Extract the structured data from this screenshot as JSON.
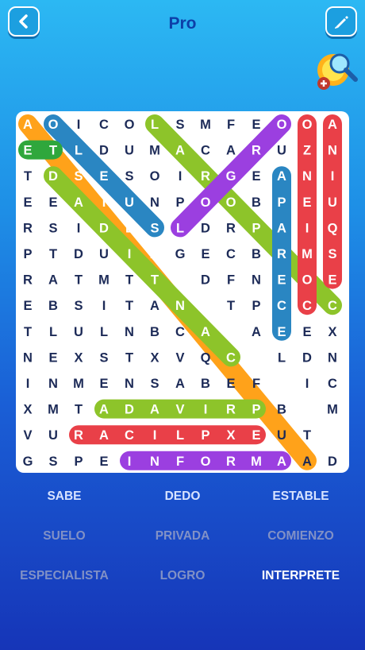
{
  "header": {
    "title": "Pro",
    "back_icon": "chevron-left-icon",
    "edit_icon": "pencil-icon",
    "hint_icon": "magnifier-hint-icon"
  },
  "grid": {
    "rows": [
      "AOICOLSMFEOOA",
      "ETLDUMACARUZN",
      "TDSESOIRGEANI",
      "EEAIUNPOOBPEU",
      "RSIDLSLDRPAIQ",
      "PTDUIAGECBRMS",
      "RATMTTIDFNEOE",
      "EBSITANCTPCCC",
      "TLULNBCAEAEEX",
      "NEXSTXVQCPLDN",
      "INMENSABEFSIC",
      "XMTADAVIRPBEM",
      "VURACILPXEUTX",
      "GSPEINFORMAAD"
    ],
    "highlights": [
      {
        "r1": 0,
        "c1": 1,
        "r2": 4,
        "c2": 5,
        "color": "#2a86c2"
      },
      {
        "r1": 0,
        "c1": 0,
        "r2": 13,
        "c2": 11,
        "color": "#ffa21a"
      },
      {
        "r1": 1,
        "c1": 0,
        "r2": 1,
        "c2": 1,
        "color": "#2fa73c"
      },
      {
        "r1": 2,
        "c1": 1,
        "r2": 9,
        "c2": 8,
        "color": "#8dc42a"
      },
      {
        "r1": 0,
        "c1": 5,
        "r2": 7,
        "c2": 12,
        "color": "#8dc42a"
      },
      {
        "r1": 0,
        "c1": 10,
        "r2": 4,
        "c2": 6,
        "color": "#9b3fe0"
      },
      {
        "r1": 2,
        "c1": 10,
        "r2": 8,
        "c2": 10,
        "color": "#2a86c2"
      },
      {
        "r1": 0,
        "c1": 11,
        "r2": 7,
        "c2": 11,
        "color": "#e94048"
      },
      {
        "r1": 0,
        "c1": 12,
        "r2": 6,
        "c2": 12,
        "color": "#e94048"
      },
      {
        "r1": 11,
        "c1": 3,
        "r2": 11,
        "c2": 9,
        "color": "#8dc42a"
      },
      {
        "r1": 12,
        "c1": 2,
        "r2": 12,
        "c2": 9,
        "color": "#e94048"
      },
      {
        "r1": 13,
        "c1": 4,
        "r2": 13,
        "c2": 10,
        "color": "#9b3fe0"
      }
    ]
  },
  "words": [
    {
      "label": "SABE",
      "state": "found"
    },
    {
      "label": "DEDO",
      "state": "found"
    },
    {
      "label": "ESTABLE",
      "state": "found"
    },
    {
      "label": "SUELO",
      "state": "todo"
    },
    {
      "label": "PRIVADA",
      "state": "todo"
    },
    {
      "label": "COMIENZO",
      "state": "todo"
    },
    {
      "label": "ESPECIALISTA",
      "state": "todo"
    },
    {
      "label": "LOGRO",
      "state": "todo"
    },
    {
      "label": "INTERPRETE",
      "state": "current"
    }
  ]
}
